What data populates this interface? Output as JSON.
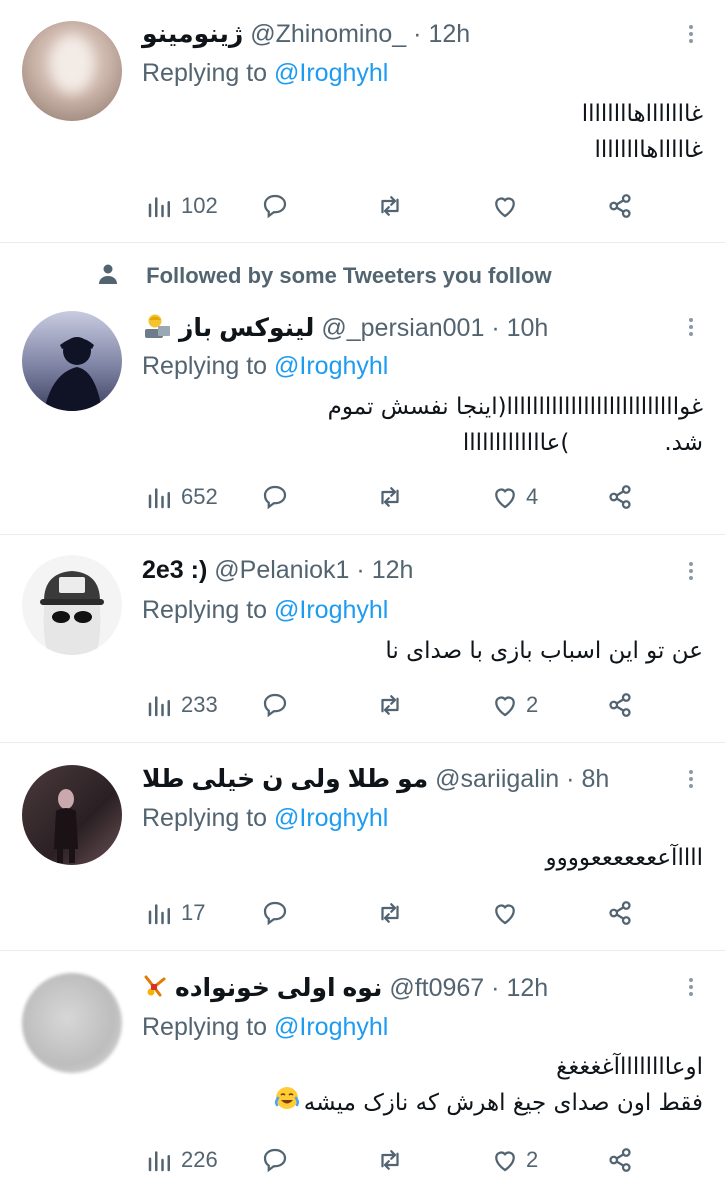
{
  "reply_prefix": "Replying to",
  "social_context": "Followed by some Tweeters you follow",
  "tweets": [
    {
      "name": "ژینومینو",
      "handle": "@Zhinomino_",
      "time": "12h",
      "reply_to": "@Iroghyhl",
      "lines": [
        "غاااااااهاااااااا",
        "غاااااهاااااااا"
      ],
      "views": "102",
      "likes": ""
    },
    {
      "name": "لینوکس باز",
      "handle": "@_persian001",
      "time": "10h",
      "reply_to": "@Iroghyhl",
      "lines": [
        "غوااااااااااااااااااااااااااا(اینجا نفسش تموم",
        "شد.             )عااااااااااااا"
      ],
      "views": "652",
      "likes": "4"
    },
    {
      "name": "2e3 :)",
      "handle": "@Pelaniok1",
      "time": "12h",
      "reply_to": "@Iroghyhl",
      "lines": [
        "عن تو این اسباب بازی با صدای نا"
      ],
      "views": "233",
      "likes": "2"
    },
    {
      "name": "مو طلا ولی ن خیلی طلا",
      "handle": "@sariigalin",
      "time": "8h",
      "reply_to": "@Iroghyhl",
      "lines": [
        "ااااآعععععععوووو"
      ],
      "views": "17",
      "likes": ""
    },
    {
      "name": "نوه اولی خونواده",
      "handle": "@ft0967",
      "time": "12h",
      "reply_to": "@Iroghyhl",
      "lines": [
        "اوعااااااااآغغغغغ",
        "فقط اون صدای جیغ اهرش که نازک میشه"
      ],
      "views": "226",
      "likes": "2"
    }
  ],
  "icons": {
    "views": "bar-chart-icon",
    "reply": "speech-bubble-icon",
    "retweet": "retweet-arrows-icon",
    "like": "heart-icon",
    "share": "share-nodes-icon",
    "more": "vertical-dots-icon",
    "person": "person-icon"
  },
  "colors": {
    "link": "#1d9bf0",
    "muted": "#536471",
    "text": "#0f1419",
    "divider": "#e6ecf0"
  }
}
